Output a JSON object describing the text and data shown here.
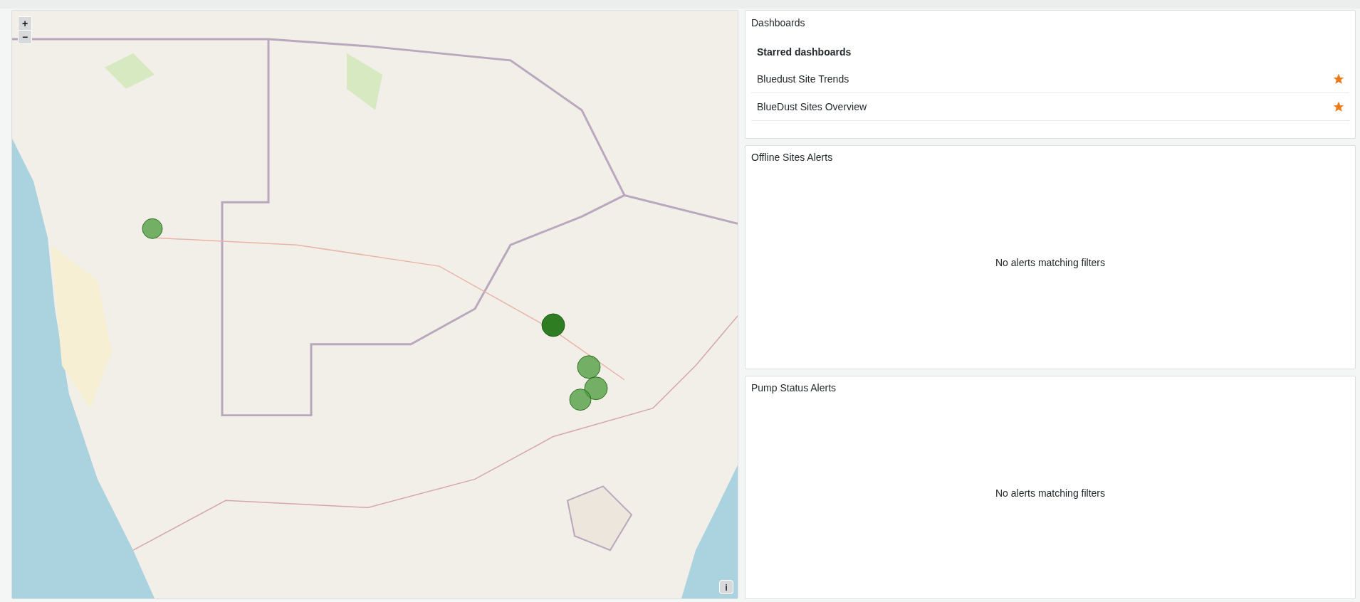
{
  "map": {
    "zoom_in": "+",
    "zoom_out": "−",
    "info": "i"
  },
  "dashboards": {
    "title": "Dashboards",
    "section": "Starred dashboards",
    "items": [
      {
        "label": "Bluedust Site Trends",
        "starred": true
      },
      {
        "label": "BlueDust Sites Overview",
        "starred": true
      }
    ]
  },
  "alert_panels": [
    {
      "title": "Offline Sites Alerts",
      "message": "No alerts matching filters"
    },
    {
      "title": "Pump Status Alerts",
      "message": "No alerts matching filters"
    }
  ]
}
